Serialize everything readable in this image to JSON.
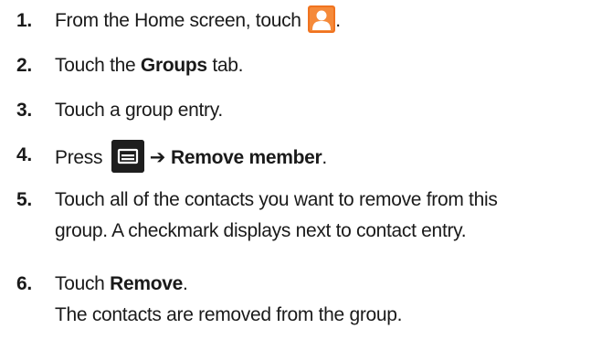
{
  "steps": [
    {
      "number": "1.",
      "text_before": "From the Home screen, touch",
      "text_after": "."
    },
    {
      "number": "2.",
      "text_before": "Touch the",
      "bold": "Groups",
      "text_after": "tab."
    },
    {
      "number": "3.",
      "text": "Touch a group entry."
    },
    {
      "number": "4.",
      "text_before": "Press",
      "arrow": "➔",
      "bold": "Remove member",
      "text_after": "."
    },
    {
      "number": "5.",
      "line1": "Touch all of the contacts you want to remove from this",
      "line2": "group. A checkmark displays next to contact entry."
    },
    {
      "number": "6.",
      "text_before": "Touch",
      "bold": "Remove",
      "text_after": ".",
      "note": "The contacts are removed from the group."
    }
  ],
  "icons": {
    "contacts": "contacts-app-icon",
    "menu": "menu-key-icon",
    "contacts_color": "#f0731f",
    "menu_color": "#1e1e1e"
  }
}
